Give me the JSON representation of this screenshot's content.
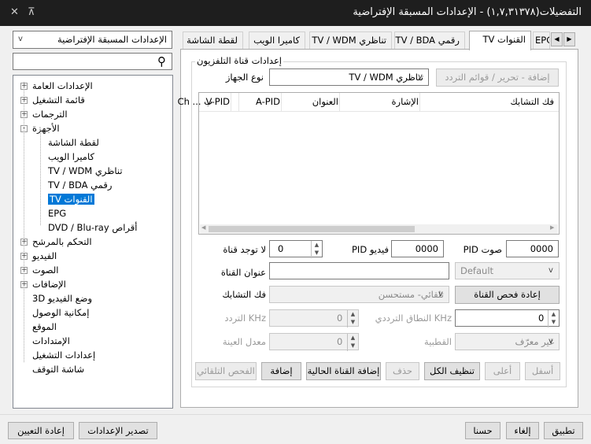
{
  "window": {
    "title": "التفضيلات(١,٧,٣١٣٧٨) - الإعدادات المسبقة الإفتراضية"
  },
  "preset": {
    "value": "الإعدادات المسبقة الإفتراضية"
  },
  "search": {
    "placeholder": ""
  },
  "tree": [
    {
      "label": "الإعدادات العامة",
      "expander": "+"
    },
    {
      "label": "قائمة التشغيل",
      "expander": "+"
    },
    {
      "label": "الترجمات",
      "expander": "+"
    },
    {
      "label": "الأجهزة",
      "expander": "-"
    },
    {
      "label": "لقطة الشاشة",
      "expander": ""
    },
    {
      "label": "كاميرا الويب",
      "expander": ""
    },
    {
      "label": "تناظري TV / WDM",
      "expander": ""
    },
    {
      "label": "رقمي TV / BDA",
      "expander": ""
    },
    {
      "label": "القنوات TV",
      "expander": ""
    },
    {
      "label": "EPG",
      "expander": ""
    },
    {
      "label": "أقراص DVD / Blu-ray",
      "expander": ""
    },
    {
      "label": "التحكم بالمرشح",
      "expander": "+"
    },
    {
      "label": "الفيديو",
      "expander": "+"
    },
    {
      "label": "الصوت",
      "expander": "+"
    },
    {
      "label": "الإضافات",
      "expander": "+"
    },
    {
      "label": "وضع الفيديو 3D",
      "expander": ""
    },
    {
      "label": "إمكانية الوصول",
      "expander": ""
    },
    {
      "label": "الموقع",
      "expander": ""
    },
    {
      "label": "الإمتدادات",
      "expander": ""
    },
    {
      "label": "إعدادات التشغيل",
      "expander": ""
    },
    {
      "label": "شاشة التوقف",
      "expander": ""
    }
  ],
  "tabs": [
    "القنوات TV",
    "رقمي TV / BDA",
    "تناظري TV / WDM",
    "كاميرا الويب",
    "لقطة الشاشة"
  ],
  "tab_partial": "EPG",
  "group": {
    "title": "إعدادات قناة التلفزيون"
  },
  "device": {
    "label": "نوع الجهاز",
    "value": "تناظري TV / WDM"
  },
  "edit_button": "إضافة - تحرير / قوائم التردد",
  "table": {
    "columns": [
      "فك التشابك",
      "الإشارة",
      "العنوان",
      "A-PID",
      "V-PID",
      "ب ... Ch"
    ]
  },
  "audio_pid": {
    "label": "صوت PID",
    "value": "0000"
  },
  "video_pid": {
    "label": "فيديو PID",
    "value": "0000"
  },
  "no_channel": {
    "label": "لا توجد قناة",
    "value": "0"
  },
  "default_combo": "Default",
  "channel_title": {
    "label": "عنوان القناة",
    "value": ""
  },
  "rescan_button": "إعادة فحص القناة",
  "deinterlace": {
    "label": "فك التشابك",
    "value": "تلقائي- مستحسن"
  },
  "bandwidth": {
    "label": "KHz النطاق الترددي",
    "value": "0"
  },
  "frequency": {
    "label": "KHz التردد",
    "value": "0"
  },
  "polarity": {
    "label": "القطبية",
    "value": "غير معرّف"
  },
  "sample_rate": {
    "label": "معدل العينة",
    "value": "0"
  },
  "actions": {
    "down": "أسفل",
    "up": "أعلى",
    "clear_all": "تنظيف الكل",
    "delete": "حذف",
    "add_current": "إضافة القناة الحالية",
    "add": "إضافة",
    "auto_scan": "الفحص التلقائي"
  },
  "footer": {
    "apply": "تطبيق",
    "cancel": "إلغاء",
    "ok": "حسنا",
    "export": "تصدير الإعدادات",
    "reset": "إعادة التعيين"
  }
}
